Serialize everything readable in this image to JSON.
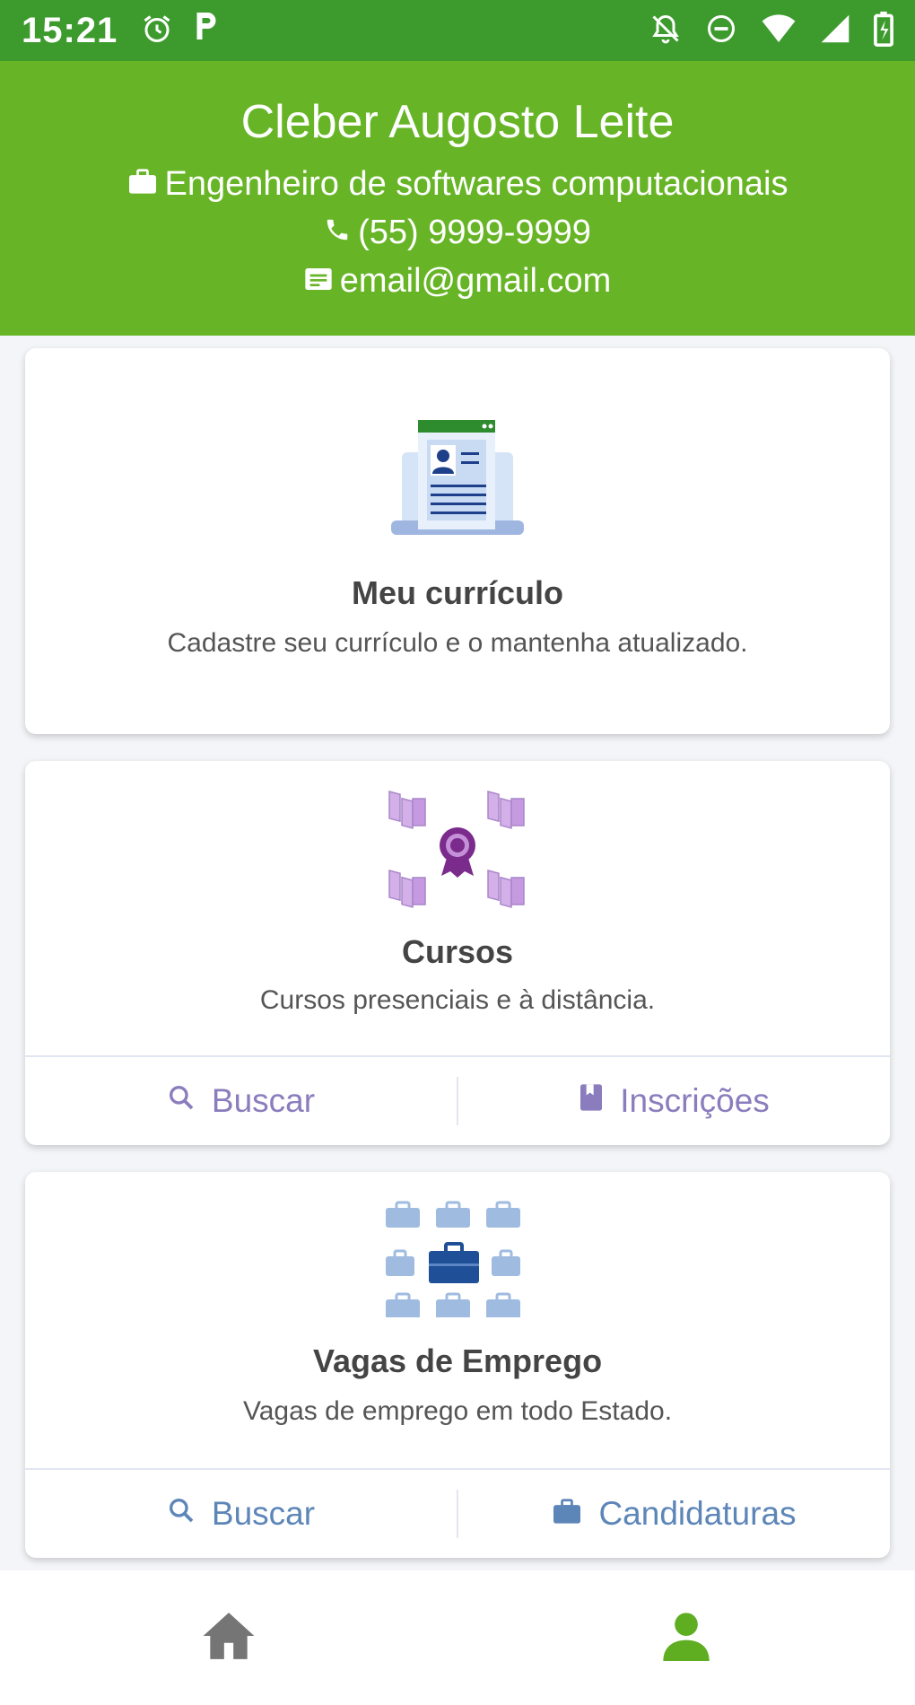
{
  "status_bar": {
    "time": "15:21",
    "icons_left": [
      "alarm-icon",
      "parking-icon"
    ],
    "icons_right": [
      "notifications-off-icon",
      "dnd-icon",
      "wifi-icon",
      "signal-icon",
      "battery-charging-icon"
    ]
  },
  "profile": {
    "name": "Cleber Augosto Leite",
    "occupation": "Engenheiro de softwares computacionais",
    "phone": "(55) 9999-9999",
    "email": "email@gmail.com"
  },
  "cards": {
    "resume": {
      "title": "Meu currículo",
      "description": "Cadastre seu currículo e o mantenha atualizado.",
      "icon": "resume-illustration"
    },
    "courses": {
      "title": "Cursos",
      "description": "Cursos presenciais e à distância.",
      "icon": "courses-illustration",
      "action_search": "Buscar",
      "action_enrollments": "Inscrições"
    },
    "jobs": {
      "title": "Vagas de Emprego",
      "description": "Vagas de emprego em todo Estado.",
      "icon": "jobs-illustration",
      "action_search": "Buscar",
      "action_applications": "Candidaturas"
    }
  },
  "bottom_nav": {
    "items": [
      {
        "icon": "home-icon",
        "active": false
      },
      {
        "icon": "person-icon",
        "active": true
      }
    ]
  },
  "colors": {
    "status_bar": "#3d9b2e",
    "header": "#67b526",
    "courses_accent": "#8b7dbd",
    "jobs_accent": "#5d86b8",
    "active_nav": "#5fae22",
    "inactive_nav": "#757575"
  }
}
